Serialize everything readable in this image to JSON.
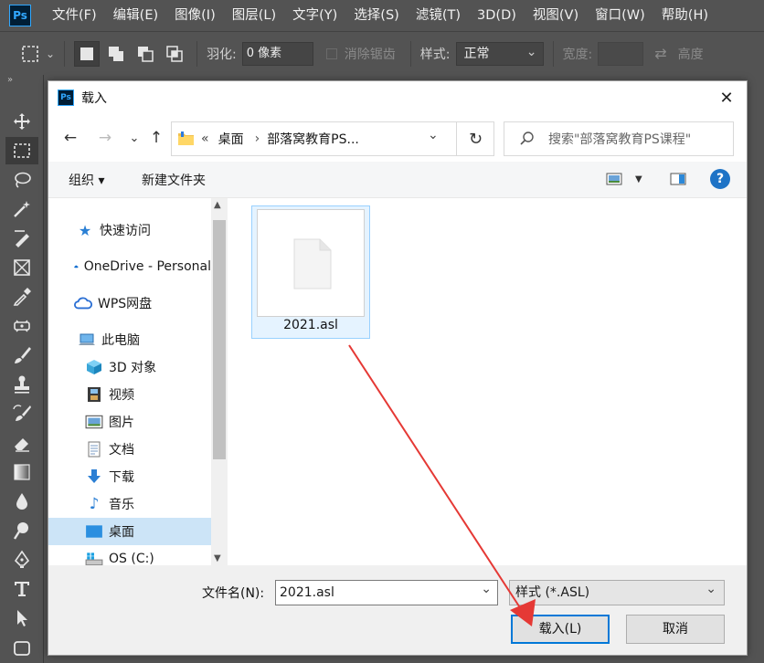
{
  "app": {
    "logo": "Ps",
    "menu": [
      "文件(F)",
      "编辑(E)",
      "图像(I)",
      "图层(L)",
      "文字(Y)",
      "选择(S)",
      "滤镜(T)",
      "3D(D)",
      "视图(V)",
      "窗口(W)",
      "帮助(H)"
    ]
  },
  "options": {
    "feather_label": "羽化:",
    "feather_value": "0 像素",
    "antialias_label": "消除锯齿",
    "style_label": "样式:",
    "style_value": "正常",
    "width_label": "宽度:",
    "height_label": "高度"
  },
  "dialog": {
    "logo": "Ps",
    "title": "载入",
    "close": "✕",
    "nav": {
      "back": "←",
      "forward": "→",
      "recent": "⌄",
      "up": "↑",
      "path_prefix": "«",
      "path": [
        "桌面",
        "部落窝教育PS..."
      ],
      "path_sep": "›",
      "refresh": "↻",
      "search_placeholder": "搜索\"部落窝教育PS课程\""
    },
    "commands": {
      "organize": "组织 ▾",
      "new_folder": "新建文件夹",
      "help": "?"
    },
    "sidebar": [
      {
        "label": "快速访问",
        "icon": "star-icon"
      },
      {
        "label": "OneDrive - Personal",
        "icon": "cloud-icon"
      },
      {
        "label": "WPS网盘",
        "icon": "wps-cloud-icon"
      },
      {
        "label": "此电脑",
        "icon": "computer-icon"
      },
      {
        "label": "3D 对象",
        "icon": "cube-icon"
      },
      {
        "label": "视频",
        "icon": "film-icon"
      },
      {
        "label": "图片",
        "icon": "picture-icon"
      },
      {
        "label": "文档",
        "icon": "document-icon"
      },
      {
        "label": "下载",
        "icon": "download-icon"
      },
      {
        "label": "音乐",
        "icon": "music-icon"
      },
      {
        "label": "桌面",
        "icon": "desktop-icon"
      },
      {
        "label": "OS (C:)",
        "icon": "drive-icon"
      }
    ],
    "file": {
      "name": "2021.asl"
    },
    "bottom": {
      "filename_label": "文件名(N):",
      "filename_value": "2021.asl",
      "filetype_value": "样式 (*.ASL)",
      "load_label": "载入(L)",
      "cancel_label": "取消"
    }
  },
  "colors": {
    "ps_chrome": "#535353",
    "selection_blue": "#cce4f7",
    "focus_blue": "#0078d7",
    "annotation_red": "#e53935"
  }
}
